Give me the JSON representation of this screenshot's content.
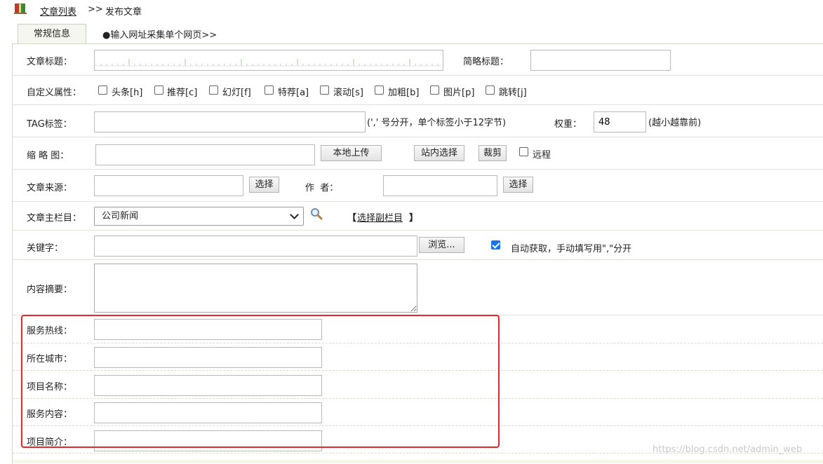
{
  "breadcrumb": {
    "link": "文章列表",
    "separator": ">>",
    "current": "发布文章"
  },
  "tabs": [
    {
      "label": "常规信息",
      "active": true
    },
    {
      "label": "●输入网址采集单个网页>>",
      "active": false
    }
  ],
  "form": {
    "title_label": "文章标题：",
    "short_title_label": "简略标题：",
    "custom_attr_label": "自定义属性：",
    "attributes": [
      {
        "label": "头条[h]",
        "checked": false
      },
      {
        "label": "推荐[c]",
        "checked": false
      },
      {
        "label": "幻灯[f]",
        "checked": false
      },
      {
        "label": "特荐[a]",
        "checked": false
      },
      {
        "label": "滚动[s]",
        "checked": false
      },
      {
        "label": "加粗[b]",
        "checked": false
      },
      {
        "label": "图片[p]",
        "checked": false
      },
      {
        "label": "跳转[j]",
        "checked": false
      }
    ],
    "tag_label": "TAG标签：",
    "tag_hint": "(',' 号分开，单个标签小于12字节)",
    "weight_label": "权重：",
    "weight_value": "48",
    "weight_hint": "(越小越靠前)",
    "thumb_label": "缩 略 图：",
    "upload_button": "本地上传",
    "site_select_button": "站内选择",
    "crop_button": "裁剪",
    "remote_label": "远程",
    "remote_checked": false,
    "source_label": "文章来源：",
    "source_select_button": "选择",
    "author_label": "作  者：",
    "author_select_button": "选择",
    "category_label": "文章主栏目：",
    "category_value": "公司新闻",
    "sub_category_prefix": "【",
    "sub_category_link": "选择副栏目",
    "sub_category_suffix": "】",
    "keywords_label": "关键字：",
    "browse_button": "浏览...",
    "auto_fetch_label": "自动获取，手动填写用\",\"分开",
    "auto_fetch_checked": true,
    "summary_label": "内容摘要：",
    "custom_fields": [
      {
        "label": "服务热线："
      },
      {
        "label": "所在城市："
      },
      {
        "label": "项目名称："
      },
      {
        "label": "服务内容："
      },
      {
        "label": "项目简介："
      }
    ]
  },
  "watermark": "https://blog.csdn.net/admin_web",
  "colors": {
    "highlight": "#e8262a",
    "checkbox_checked": "#1a73e8"
  }
}
